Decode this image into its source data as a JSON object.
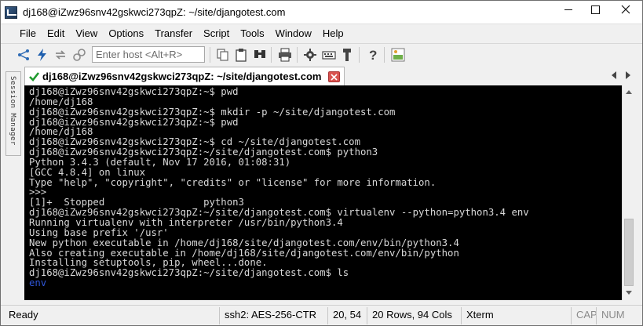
{
  "window": {
    "title": "dj168@iZwz96snv42gskwci273qpZ: ~/site/djangotest.com"
  },
  "menu": [
    "File",
    "Edit",
    "View",
    "Options",
    "Transfer",
    "Script",
    "Tools",
    "Window",
    "Help"
  ],
  "toolbar": {
    "host_placeholder": "Enter host <Alt+R>",
    "icons": [
      "connect-icon",
      "quick-connect-icon",
      "reconnect-icon",
      "disconnect-icon",
      "copy-icon",
      "paste-icon",
      "find-icon",
      "print-icon",
      "session-options-icon",
      "keymap-icon",
      "sftp-icon",
      "help-icon",
      "screenshot-icon"
    ]
  },
  "side_panel": {
    "label": "Session Manager"
  },
  "tab": {
    "label": "dj168@iZwz96snv42gskwci273qpZ: ~/site/djangotest.com"
  },
  "terminal": {
    "lines": [
      "dj168@iZwz96snv42gskwci273qpZ:~$ pwd",
      "/home/dj168",
      "dj168@iZwz96snv42gskwci273qpZ:~$ mkdir -p ~/site/djangotest.com",
      "dj168@iZwz96snv42gskwci273qpZ:~$ pwd",
      "/home/dj168",
      "dj168@iZwz96snv42gskwci273qpZ:~$ cd ~/site/djangotest.com",
      "dj168@iZwz96snv42gskwci273qpZ:~/site/djangotest.com$ python3",
      "Python 3.4.3 (default, Nov 17 2016, 01:08:31)",
      "[GCC 4.8.4] on linux",
      "Type \"help\", \"copyright\", \"credits\" or \"license\" for more information.",
      ">>>",
      "[1]+  Stopped                 python3",
      "dj168@iZwz96snv42gskwci273qpZ:~/site/djangotest.com$ virtualenv --python=python3.4 env",
      "Running virtualenv with interpreter /usr/bin/python3.4",
      "Using base prefix '/usr'",
      "New python executable in /home/dj168/site/djangotest.com/env/bin/python3.4",
      "Also creating executable in /home/dj168/site/djangotest.com/env/bin/python",
      "Installing setuptools, pip, wheel...done.",
      "dj168@iZwz96snv42gskwci273qpZ:~/site/djangotest.com$ ls",
      "env"
    ],
    "highlight_color": "#2f56d8"
  },
  "status": {
    "ready": "Ready",
    "cipher": "ssh2: AES-256-CTR",
    "cursor": "20,  54",
    "size": "20 Rows, 94 Cols",
    "term_type": "Xterm",
    "cap": "CAP",
    "num": "NUM"
  }
}
